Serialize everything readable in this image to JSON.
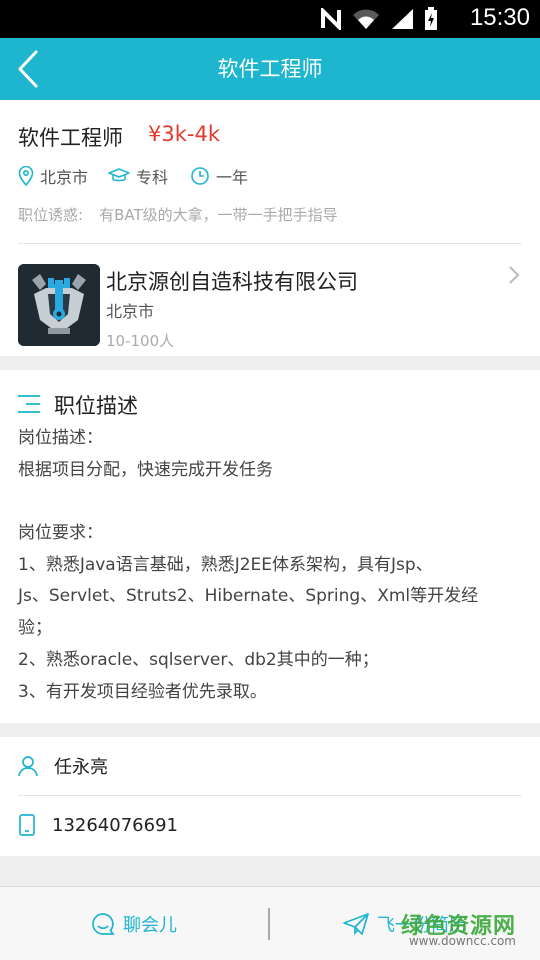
{
  "status_bar": {
    "time": "15:30"
  },
  "header": {
    "title": "软件工程师"
  },
  "job": {
    "title": "软件工程师",
    "salary": "¥3k-4k",
    "city": "北京市",
    "education": "专科",
    "experience": "一年",
    "perk_label": "职位诱惑:",
    "perk_text": "有BAT级的大拿，一带一手把手指导"
  },
  "company": {
    "name": "北京源创自造科技有限公司",
    "city": "北京市",
    "size": "10-100人"
  },
  "description": {
    "section_title": "职位描述",
    "lines": [
      "岗位描述：",
      "根据项目分配，快速完成开发任务",
      "",
      "岗位要求：",
      "1、熟悉Java语言基础，熟悉J2EE体系架构，具有Jsp、",
      "Js、Servlet、Struts2、Hibernate、Spring、Xml等开发经",
      "验；",
      "2、熟悉oracle、sqlserver、db2其中的一种；",
      "3、有开发项目经验者优先录取。"
    ]
  },
  "contact": {
    "name": "任永亮",
    "phone": "13264076691"
  },
  "bottom_bar": {
    "chat_label": "聊会儿",
    "send_label": "飞一份简历"
  },
  "watermark": {
    "brand": "绿色资源网",
    "url": "www.downcc.com"
  },
  "colors": {
    "accent": "#1eb5cf",
    "salary": "#e23a2e"
  }
}
